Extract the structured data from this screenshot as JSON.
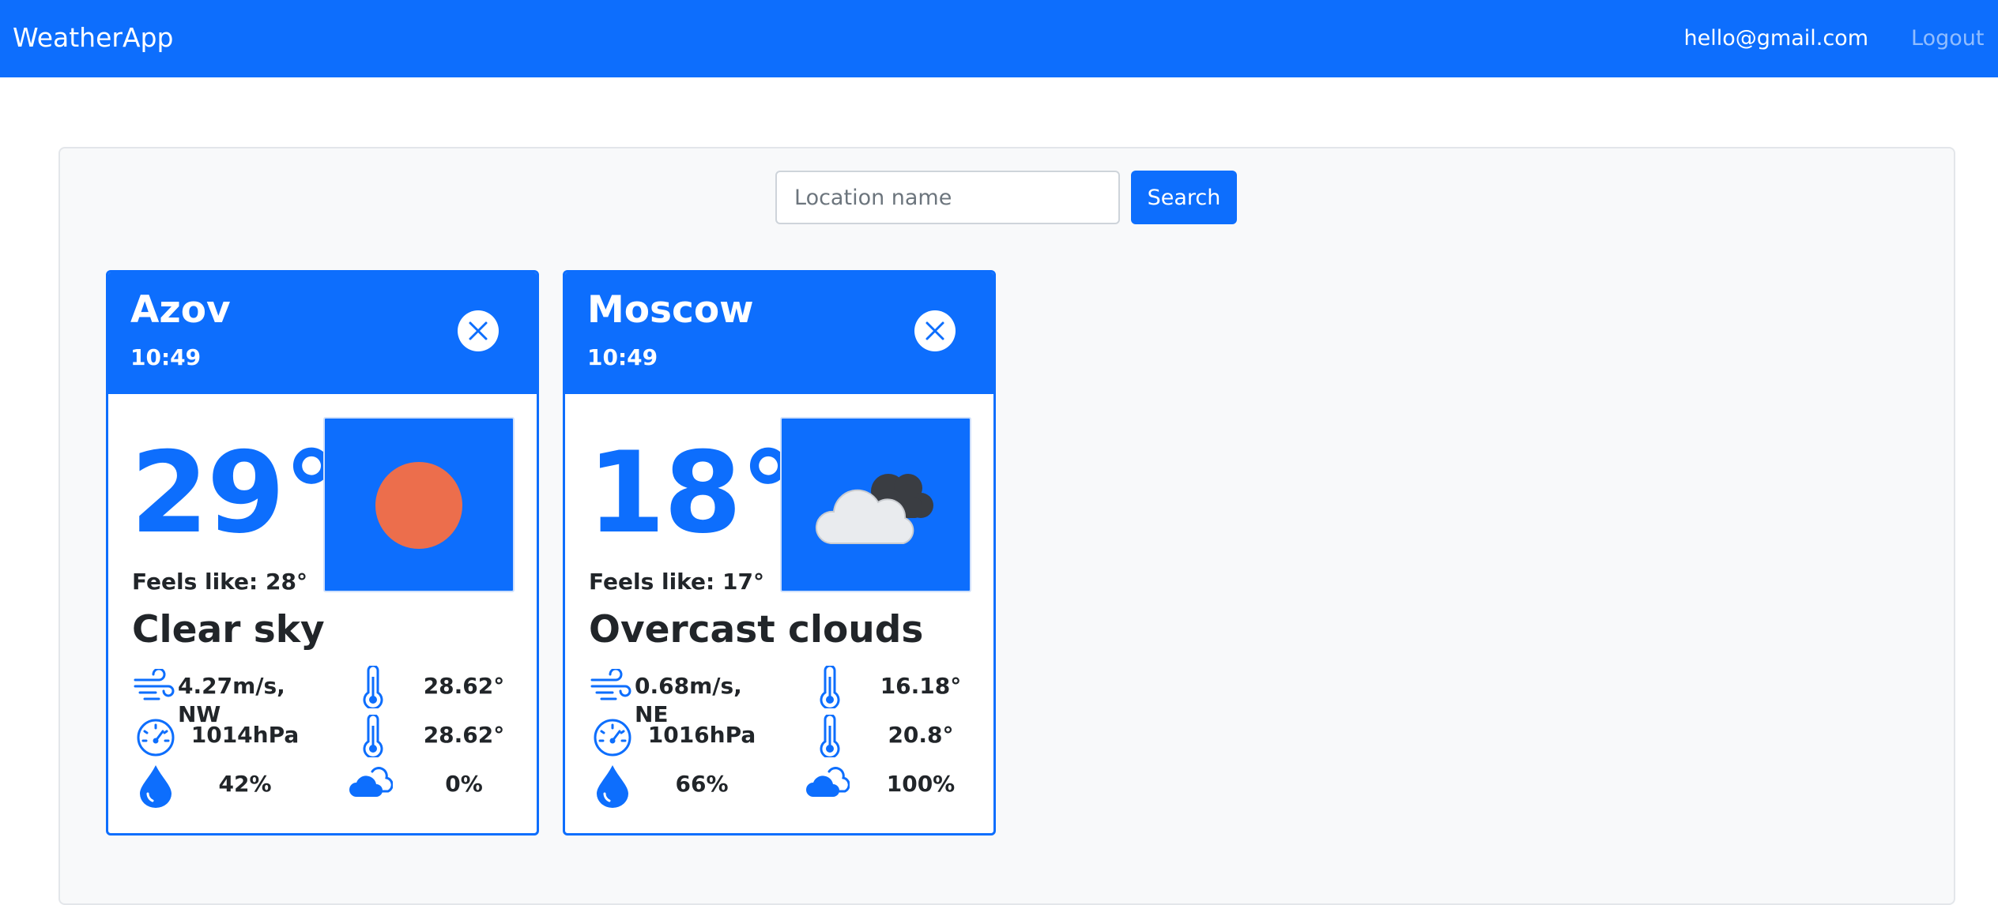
{
  "navbar": {
    "brand": "WeatherApp",
    "email": "hello@gmail.com",
    "logout": "Logout"
  },
  "search": {
    "placeholder": "Location name",
    "value": "",
    "button": "Search"
  },
  "cards": [
    {
      "city": "Azov",
      "time": "10:49",
      "temp": "29°",
      "feels_like": "Feels like: 28°",
      "description": "Clear sky",
      "icon": "clear-sky-icon",
      "wind": "4.27m/s, NW",
      "temp_a": "28.62°",
      "pressure": "1014hPa",
      "temp_b": "28.62°",
      "humidity": "42%",
      "clouds": "0%"
    },
    {
      "city": "Moscow",
      "time": "10:49",
      "temp": "18°",
      "feels_like": "Feels like: 17°",
      "description": "Overcast clouds",
      "icon": "overcast-clouds-icon",
      "wind": "0.68m/s, NE",
      "temp_a": "16.18°",
      "pressure": "1016hPa",
      "temp_b": "20.8°",
      "humidity": "66%",
      "clouds": "100%"
    }
  ],
  "colors": {
    "primary": "#0d6efd",
    "sun": "#ec6e4c",
    "panel": "#f8f9fa"
  }
}
